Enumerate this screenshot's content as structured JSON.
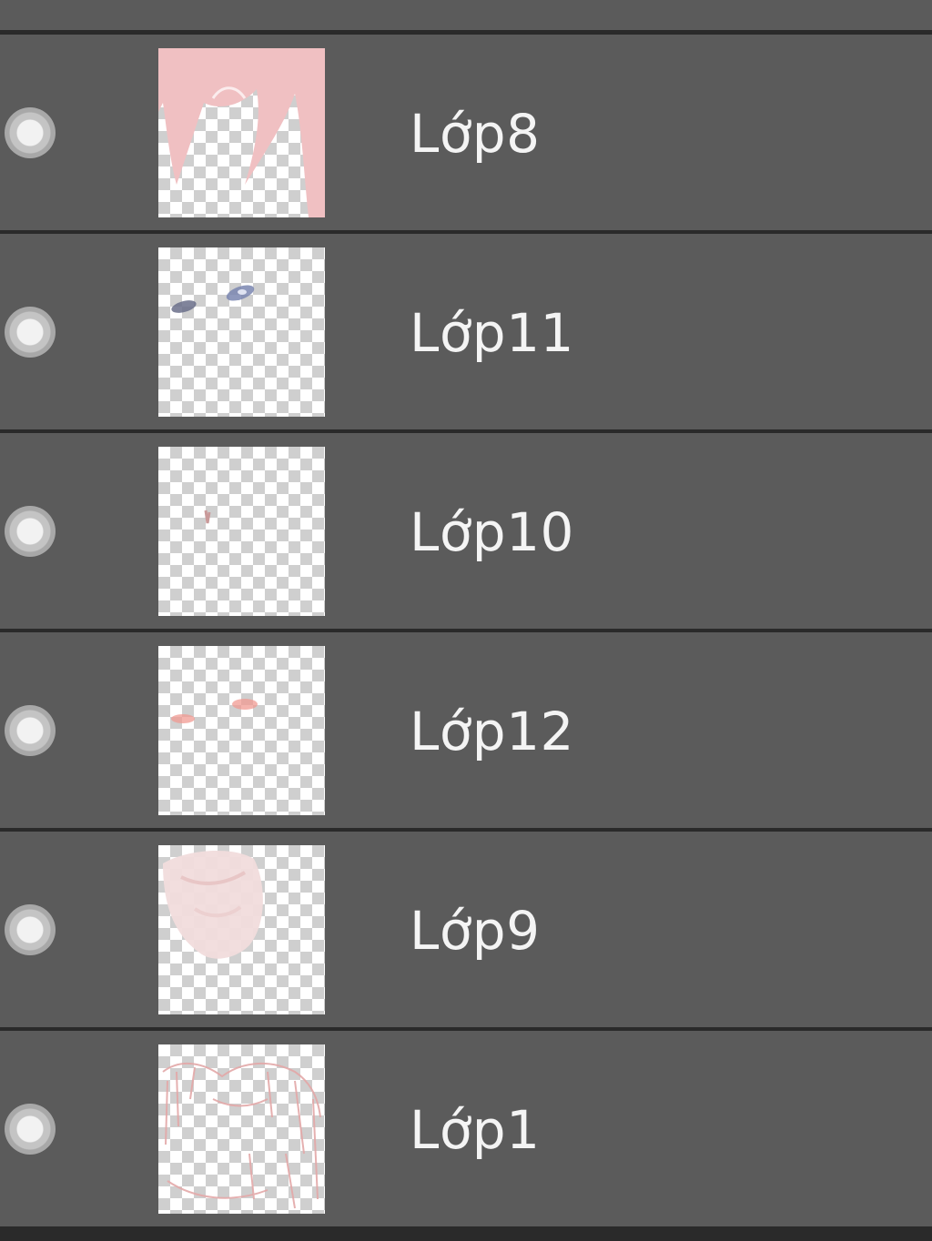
{
  "layers_panel": {
    "layers": [
      {
        "name": "Lớp8",
        "thumbnail": "pink-hair-art"
      },
      {
        "name": "Lớp11",
        "thumbnail": "eyes-art"
      },
      {
        "name": "Lớp10",
        "thumbnail": "small-mark-art"
      },
      {
        "name": "Lớp12",
        "thumbnail": "blush-art"
      },
      {
        "name": "Lớp9",
        "thumbnail": "face-shading-art"
      },
      {
        "name": "Lớp1",
        "thumbnail": "line-sketch-art"
      }
    ],
    "visibility_icon": "visibility-dot-icon"
  },
  "colors": {
    "panel_bg": "#5b5b5b",
    "separator": "#2a2a2a",
    "text": "#f4f4f4",
    "hair_pink": "#f0c0c2"
  }
}
